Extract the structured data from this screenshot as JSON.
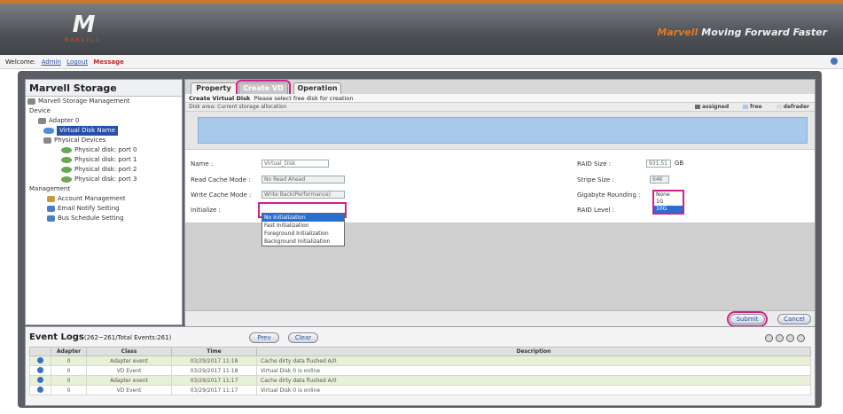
{
  "header": {
    "brand_word": "Marvell",
    "slogan": "Moving Forward Faster"
  },
  "subbar": {
    "prefix": "Welcome:",
    "user": "Admin",
    "logout": "Logout",
    "alert": "Message"
  },
  "left_panel": {
    "title": "Marvell Storage",
    "tree": [
      "Marvell Storage Management",
      "Device",
      "Adapter 0",
      "Virtual Disk Name",
      "Physical Devices",
      "Physical disk: port 0",
      "Physical disk: port 1",
      "Physical disk: port 2",
      "Physical disk: port 3",
      "Management",
      "Account Management",
      "Email Notify Setting",
      "Bus Schedule Setting"
    ]
  },
  "tabs": [
    "Property",
    "Create VD",
    "Operation"
  ],
  "crumb": {
    "title": "Create Virtual Disk",
    "hint": "Please select free disk for creation"
  },
  "infobar": {
    "text": "Disk area: Current storage allocation",
    "legend": [
      "assigned",
      "free",
      "defrader"
    ]
  },
  "form": {
    "name_label": "Name :",
    "name_value": "Virtual_Disk",
    "read_cache_label": "Read Cache Mode :",
    "read_cache_value": "No Read Ahead",
    "write_cache_label": "Write Cache Mode :",
    "write_cache_value": "Write Back(Performance)",
    "initialize_label": "Initialize :",
    "raid_size_label": "RAID Size :",
    "raid_size_value": "931.51",
    "raid_size_unit": "GB",
    "stripe_label": "Stripe Size :",
    "stripe_value": "64K",
    "gigabyte_label": "Gigabyte Rounding :",
    "raid_level_label": "RAID Level :"
  },
  "initialize_options": [
    "No Initialization",
    "Fast Initialization",
    "Foreground Initialization",
    "Background Initialization"
  ],
  "rounding_options": [
    "None",
    "1G",
    "10G"
  ],
  "buttons": {
    "submit": "Submit",
    "cancel": "Cancel"
  },
  "events": {
    "title": "Event Logs",
    "range": "(262~261/Total Events:261)",
    "prev": "Prev",
    "clear": "Clear",
    "columns": [
      "Adapter",
      "Class",
      "Time",
      "Description"
    ],
    "rows": [
      {
        "adapter": "0",
        "class": "Adapter event",
        "time": "03/29/2017 11:18",
        "desc": "Cache dirty data flushed A/0"
      },
      {
        "adapter": "0",
        "class": "VD Event",
        "time": "03/29/2017 11:18",
        "desc": "Virtual Disk 0 is online"
      },
      {
        "adapter": "0",
        "class": "Adapter event",
        "time": "03/29/2017 11:17",
        "desc": "Cache dirty data flushed A/0"
      },
      {
        "adapter": "0",
        "class": "VD Event",
        "time": "03/29/2017 11:17",
        "desc": "Virtual Disk 0 is online"
      }
    ]
  },
  "colors": {
    "highlight": "#d0208a",
    "accent_orange": "#e07a2a",
    "vd_bar": "#a9c9ea"
  }
}
